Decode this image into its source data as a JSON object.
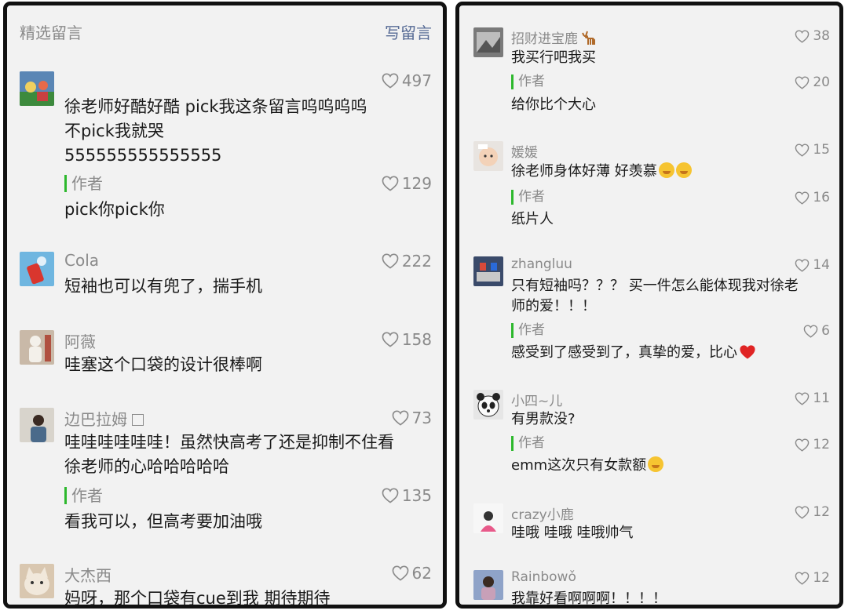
{
  "left_panel": {
    "header": {
      "title": "精选留言",
      "write_label": "写留言"
    },
    "comments": [
      {
        "lines": [
          "徐老师好酷好酷 pick我这条留言呜呜呜呜",
          "不pick我就哭",
          "555555555555555"
        ],
        "likes": "497",
        "avatar_icon": "cartoon-avatar",
        "reply": {
          "label": "作者",
          "text": "pick你pick你",
          "likes": "129"
        }
      },
      {
        "name": "Cola",
        "lines": [
          "短袖也可以有兜了，揣手机"
        ],
        "likes": "222",
        "avatar_icon": "drink-avatar"
      },
      {
        "name": "阿薇",
        "lines": [
          "哇塞这个口袋的设计很棒啊"
        ],
        "likes": "158",
        "avatar_icon": "figure-avatar"
      },
      {
        "name": "边巴拉姆",
        "lines": [
          "哇哇哇哇哇哇！虽然快高考了还是抑制不住看",
          "徐老师的心哈哈哈哈哈"
        ],
        "likes": "73",
        "avatar_icon": "person-avatar",
        "reply": {
          "label": "作者",
          "text": "看我可以，但高考要加油哦",
          "likes": "135"
        }
      },
      {
        "name": "大杰西",
        "lines": [
          "妈呀，那个口袋有cue到我 期待期待"
        ],
        "likes": "62",
        "avatar_icon": "cat-avatar"
      }
    ]
  },
  "right_panel": {
    "comments": [
      {
        "name": "招财进宝鹿",
        "lines": [
          "我买行吧我买"
        ],
        "likes": "38",
        "avatar_icon": "photo-avatar",
        "reply": {
          "label": "作者",
          "text": "给你比个大心",
          "likes": "20"
        }
      },
      {
        "name": "媛媛",
        "lines": [
          "徐老师身体好薄 好羡慕"
        ],
        "likes": "15",
        "avatar_icon": "baby-avatar",
        "reply": {
          "label": "作者",
          "text": "纸片人",
          "likes": "16"
        }
      },
      {
        "name": "zhangluu",
        "lines": [
          "只有短袖吗？？？ 买一件怎么能体现我对徐老",
          "师的爱！！！"
        ],
        "likes": "14",
        "avatar_icon": "scene-avatar",
        "reply": {
          "label": "作者",
          "text": "感受到了感受到了，真挚的爱，比心",
          "likes": "6"
        }
      },
      {
        "name": "小四~儿",
        "lines": [
          "有男款没?"
        ],
        "likes": "11",
        "avatar_icon": "panda-avatar",
        "reply": {
          "label": "作者",
          "text": "emm这次只有女款额",
          "likes": "12"
        }
      },
      {
        "name": "crazy小鹿",
        "lines": [
          "哇哦 哇哦 哇哦帅气"
        ],
        "likes": "12",
        "avatar_icon": "girl-avatar"
      },
      {
        "name": "Rainbowǒ",
        "lines": [
          "我靠好看啊啊啊！！！！"
        ],
        "likes": "12",
        "avatar_icon": "portrait-avatar"
      }
    ]
  },
  "colors": {
    "like_gray": "#8a8a8a",
    "link_blue": "#576b95",
    "author_bar_green": "#2db82d",
    "panel_bg": "#f2f2f2",
    "heart_red": "#e02424"
  }
}
